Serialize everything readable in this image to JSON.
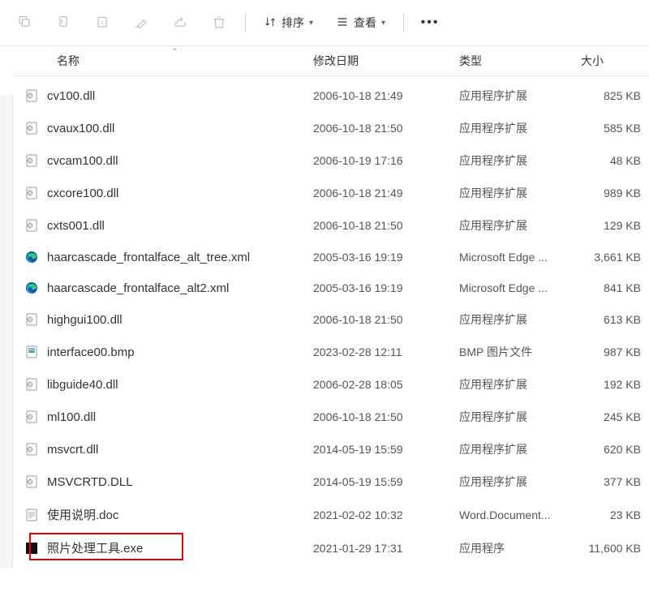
{
  "toolbar": {
    "sort_label": "排序",
    "view_label": "查看"
  },
  "headers": {
    "name": "名称",
    "date": "修改日期",
    "type": "类型",
    "size": "大小"
  },
  "files": [
    {
      "icon": "dll",
      "name": "cv100.dll",
      "date": "2006-10-18 21:49",
      "type": "应用程序扩展",
      "size": "825 KB"
    },
    {
      "icon": "dll",
      "name": "cvaux100.dll",
      "date": "2006-10-18 21:50",
      "type": "应用程序扩展",
      "size": "585 KB"
    },
    {
      "icon": "dll",
      "name": "cvcam100.dll",
      "date": "2006-10-19 17:16",
      "type": "应用程序扩展",
      "size": "48 KB"
    },
    {
      "icon": "dll",
      "name": "cxcore100.dll",
      "date": "2006-10-18 21:49",
      "type": "应用程序扩展",
      "size": "989 KB"
    },
    {
      "icon": "dll",
      "name": "cxts001.dll",
      "date": "2006-10-18 21:50",
      "type": "应用程序扩展",
      "size": "129 KB"
    },
    {
      "icon": "edge",
      "name": "haarcascade_frontalface_alt_tree.xml",
      "date": "2005-03-16 19:19",
      "type": "Microsoft Edge ...",
      "size": "3,661 KB"
    },
    {
      "icon": "edge",
      "name": "haarcascade_frontalface_alt2.xml",
      "date": "2005-03-16 19:19",
      "type": "Microsoft Edge ...",
      "size": "841 KB"
    },
    {
      "icon": "dll",
      "name": "highgui100.dll",
      "date": "2006-10-18 21:50",
      "type": "应用程序扩展",
      "size": "613 KB"
    },
    {
      "icon": "bmp",
      "name": "interface00.bmp",
      "date": "2023-02-28 12:11",
      "type": "BMP 图片文件",
      "size": "987 KB"
    },
    {
      "icon": "dll",
      "name": "libguide40.dll",
      "date": "2006-02-28 18:05",
      "type": "应用程序扩展",
      "size": "192 KB"
    },
    {
      "icon": "dll",
      "name": "ml100.dll",
      "date": "2006-10-18 21:50",
      "type": "应用程序扩展",
      "size": "245 KB"
    },
    {
      "icon": "dll",
      "name": "msvcrt.dll",
      "date": "2014-05-19 15:59",
      "type": "应用程序扩展",
      "size": "620 KB"
    },
    {
      "icon": "dll",
      "name": "MSVCRTD.DLL",
      "date": "2014-05-19 15:59",
      "type": "应用程序扩展",
      "size": "377 KB"
    },
    {
      "icon": "doc",
      "name": "使用说明.doc",
      "date": "2021-02-02 10:32",
      "type": "Word.Document...",
      "size": "23 KB"
    },
    {
      "icon": "exe",
      "name": "照片处理工具.exe",
      "date": "2021-01-29 17:31",
      "type": "应用程序",
      "size": "11,600 KB",
      "highlight": true
    }
  ]
}
